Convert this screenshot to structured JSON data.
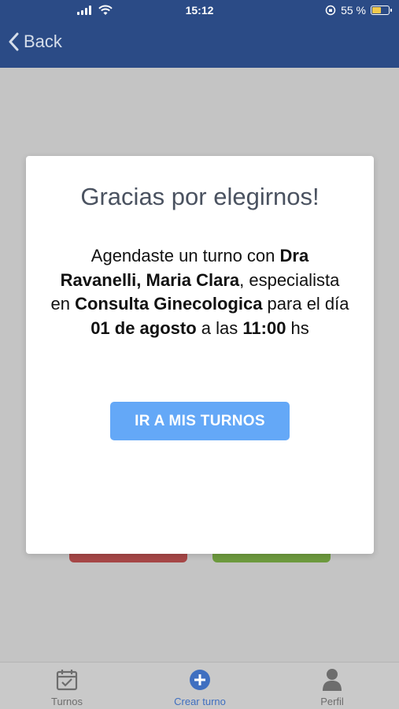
{
  "status_bar": {
    "time": "15:12",
    "battery_percent": "55 %"
  },
  "nav": {
    "back_label": "Back"
  },
  "modal": {
    "title": "Gracias por elegirnos!",
    "message": {
      "p1": "Agendaste un turno con ",
      "doctor": "Dra Ravanelli, Maria Clara",
      "p2": ", especialista en ",
      "specialty": "Consulta Ginecologica",
      "p3": " para el día ",
      "date": "01 de agosto",
      "p4": " a las ",
      "time": "11:00",
      "p5": " hs"
    },
    "button_label": "IR A MIS TURNOS"
  },
  "tabs": [
    {
      "label": "Turnos",
      "icon": "calendar-check-icon"
    },
    {
      "label": "Crear turno",
      "icon": "plus-circle-icon"
    },
    {
      "label": "Perfil",
      "icon": "user-icon"
    }
  ],
  "colors": {
    "header": "#2b4b86",
    "primary_button": "#64a8f7",
    "active_tab": "#3f6fc0",
    "cancel_button": "#a64747",
    "confirm_button": "#6d9a3e",
    "battery": "#f2c94c"
  }
}
